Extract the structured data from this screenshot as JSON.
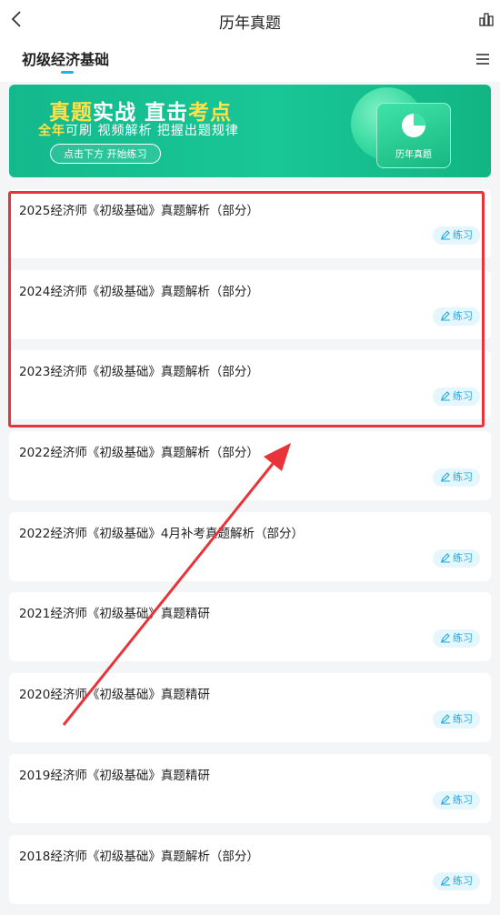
{
  "header": {
    "title": "历年真题",
    "back_icon": "back-chevron-icon",
    "stats_icon": "stats-icon"
  },
  "subnav": {
    "active_tab": "初级经济基础",
    "menu_icon": "menu-icon"
  },
  "banner": {
    "line1_a": "真题",
    "line1_b": "实战 直击",
    "line1_c": "考点",
    "line2_a": "全年",
    "line2_b": "可刷 视频解析 把握出题规律",
    "button": "点击下方 开始练习",
    "card_label": "历年真题"
  },
  "practice_label": "练习",
  "items": [
    {
      "title": "2025经济师《初级基础》真题解析（部分）"
    },
    {
      "title": "2024经济师《初级基础》真题解析（部分）"
    },
    {
      "title": "2023经济师《初级基础》真题解析（部分）"
    },
    {
      "title": "2022经济师《初级基础》真题解析（部分）"
    },
    {
      "title": "2022经济师《初级基础》4月补考真题解析（部分）"
    },
    {
      "title": "2021经济师《初级基础》真题精研"
    },
    {
      "title": "2020经济师《初级基础》真题精研"
    },
    {
      "title": "2019经济师《初级基础》真题精研"
    },
    {
      "title": "2018经济师《初级基础》真题解析（部分）"
    }
  ],
  "colors": {
    "accent": "#21a7de",
    "banner": "#16bf8e",
    "highlight": "#e8333a"
  }
}
